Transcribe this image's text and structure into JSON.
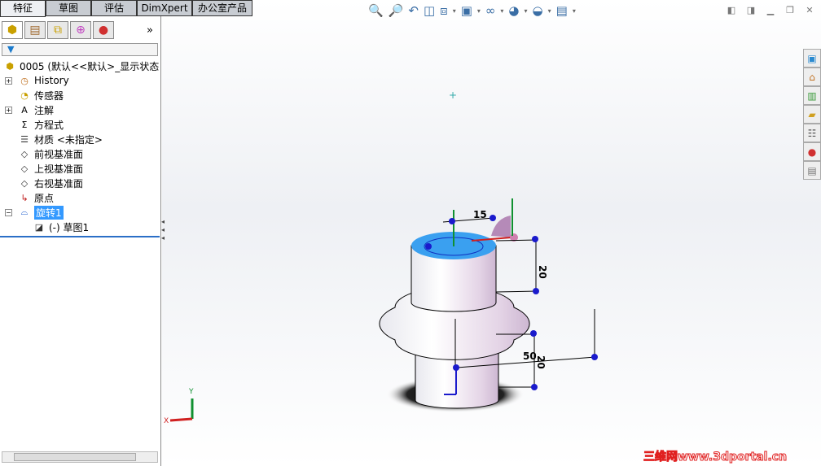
{
  "tabs": [
    "特征",
    "草图",
    "评估",
    "DimXpert",
    "办公室产品"
  ],
  "panel": {
    "tool_icons": [
      "feature-manager-icon",
      "property-manager-icon",
      "configuration-manager-icon",
      "dimxpert-manager-icon",
      "display-manager-icon"
    ],
    "more": "»",
    "filter": "filter-icon"
  },
  "tree": [
    {
      "label": "0005  (默认<<默认>_显示状态",
      "icon": "part-icon",
      "expand": ""
    },
    {
      "label": "History",
      "icon": "history-icon",
      "expand": "+"
    },
    {
      "label": "传感器",
      "icon": "sensor-icon",
      "expand": ""
    },
    {
      "label": "注解",
      "icon": "annotation-icon",
      "expand": "+"
    },
    {
      "label": "方程式",
      "icon": "equation-icon",
      "expand": ""
    },
    {
      "label": "材质 <未指定>",
      "icon": "material-icon",
      "expand": ""
    },
    {
      "label": "前视基准面",
      "icon": "plane-icon",
      "expand": ""
    },
    {
      "label": "上视基准面",
      "icon": "plane-icon",
      "expand": ""
    },
    {
      "label": "右视基准面",
      "icon": "plane-icon",
      "expand": ""
    },
    {
      "label": "原点",
      "icon": "origin-icon",
      "expand": ""
    },
    {
      "label": "旋转1",
      "icon": "revolve-icon",
      "expand": "−",
      "selected": true
    },
    {
      "label": "(-) 草图1",
      "icon": "sketch-icon",
      "expand": ""
    }
  ],
  "view_toolbar": [
    "zoom-to-fit-icon",
    "zoom-area-icon",
    "previous-view-icon",
    "section-view-icon",
    "view-orientation-icon",
    "display-style-icon",
    "hide-show-icon",
    "edit-appearance-icon",
    "apply-scene-icon",
    "view-settings-icon"
  ],
  "dimensions": {
    "top_width": "15",
    "upper_height": "20",
    "lower_height": "20",
    "radius": "50"
  },
  "triad": {
    "x": "X",
    "y": "Y"
  },
  "watermark": "三维网www.3dportal.cn",
  "colors": {
    "selected_face": "#3aa0f0",
    "selection": "#3399ff",
    "dim_point": "#1a1acc"
  }
}
